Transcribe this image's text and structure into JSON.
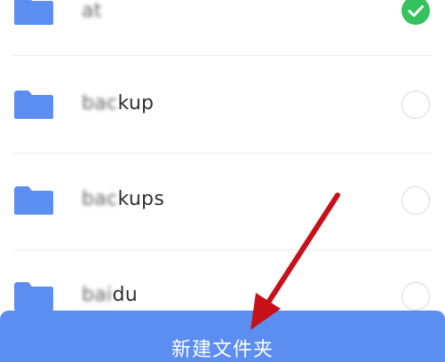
{
  "colors": {
    "folder": "#5b8ef0",
    "check_on": "#36c25e",
    "button_bg": "#5b8ef0",
    "arrow": "#c8101a"
  },
  "folders": [
    {
      "prefix": "a",
      "suffix": "t",
      "selected": true,
      "icon": "folder-icon"
    },
    {
      "prefix": "bac",
      "suffix": "kup",
      "selected": false,
      "icon": "folder-icon"
    },
    {
      "prefix": "bac",
      "suffix": "kups",
      "selected": false,
      "icon": "folder-icon"
    },
    {
      "prefix": "bai",
      "suffix": "du",
      "selected": false,
      "icon": "folder-icon"
    }
  ],
  "bottom_button": {
    "label": "新建文件夹"
  }
}
